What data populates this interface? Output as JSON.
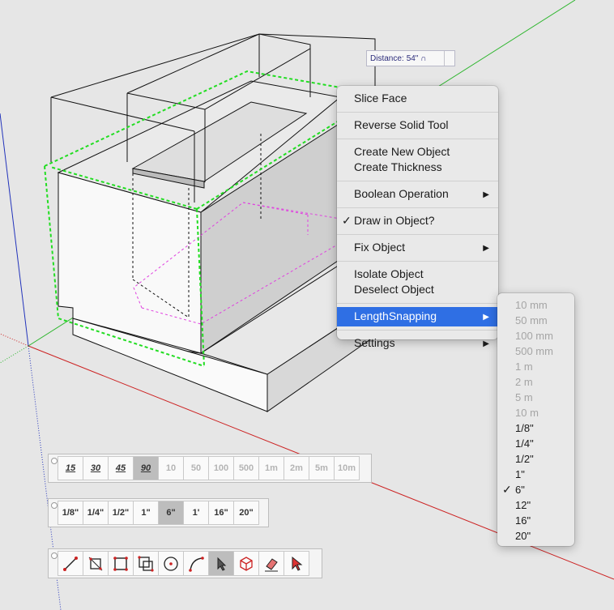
{
  "vcb": {
    "label": "Distance:",
    "value": "54\" ∩"
  },
  "context_menu": {
    "items": [
      {
        "lines": [
          "Slice Face"
        ]
      },
      {
        "lines": [
          "Reverse Solid Tool"
        ]
      },
      {
        "lines": [
          "Create New Object",
          "Create Thickness"
        ]
      },
      {
        "lines": [
          "Boolean Operation"
        ],
        "submenu": true
      },
      {
        "lines": [
          "Draw in Object?"
        ],
        "checked": true
      },
      {
        "lines": [
          "Fix Object"
        ],
        "submenu": true
      },
      {
        "lines": [
          "Isolate Object",
          "Deselect Object"
        ]
      },
      {
        "lines": [
          "LengthSnapping"
        ],
        "submenu": true,
        "highlighted": true
      },
      {
        "lines": [
          "Settings"
        ],
        "submenu": true
      }
    ]
  },
  "length_snapping_menu": {
    "items": [
      {
        "label": "10 mm",
        "enabled": false
      },
      {
        "label": "50 mm",
        "enabled": false
      },
      {
        "label": "100 mm",
        "enabled": false
      },
      {
        "label": "500 mm",
        "enabled": false
      },
      {
        "label": "1 m",
        "enabled": false
      },
      {
        "label": "2 m",
        "enabled": false
      },
      {
        "label": "5 m",
        "enabled": false
      },
      {
        "label": "10 m",
        "enabled": false
      },
      {
        "label": "1/8\"",
        "enabled": true
      },
      {
        "label": "1/4\"",
        "enabled": true
      },
      {
        "label": "1/2\"",
        "enabled": true
      },
      {
        "label": "1\"",
        "enabled": true
      },
      {
        "label": "6\"",
        "enabled": true,
        "checked": true
      },
      {
        "label": "12\"",
        "enabled": true
      },
      {
        "label": "16\"",
        "enabled": true
      },
      {
        "label": "20\"",
        "enabled": true
      }
    ]
  },
  "angle_toolbar": {
    "buttons": [
      {
        "label": "15",
        "kind": "angle"
      },
      {
        "label": "30",
        "kind": "angle"
      },
      {
        "label": "45",
        "kind": "angle"
      },
      {
        "label": "90",
        "kind": "angle",
        "active": true
      },
      {
        "label": "10",
        "kind": "dim"
      },
      {
        "label": "50",
        "kind": "dim"
      },
      {
        "label": "100",
        "kind": "dim"
      },
      {
        "label": "500",
        "kind": "dim"
      },
      {
        "label": "1m",
        "kind": "dim"
      },
      {
        "label": "2m",
        "kind": "dim"
      },
      {
        "label": "5m",
        "kind": "dim"
      },
      {
        "label": "10m",
        "kind": "dim"
      }
    ]
  },
  "length_toolbar": {
    "buttons": [
      {
        "label": "1/8\""
      },
      {
        "label": "1/4\""
      },
      {
        "label": "1/2\""
      },
      {
        "label": "1\""
      },
      {
        "label": "6\"",
        "active": true
      },
      {
        "label": "1'"
      },
      {
        "label": "16\""
      },
      {
        "label": "20\""
      }
    ]
  },
  "tools_toolbar": {
    "buttons": [
      {
        "icon": "line-tool-icon"
      },
      {
        "icon": "rotated-rectangle-icon"
      },
      {
        "icon": "rectangle-icon"
      },
      {
        "icon": "offset-rectangle-icon"
      },
      {
        "icon": "circle-icon"
      },
      {
        "icon": "arc-icon"
      },
      {
        "icon": "select-in-object-icon",
        "active": true
      },
      {
        "icon": "solid-box-icon"
      },
      {
        "icon": "eraser-icon"
      },
      {
        "icon": "select-arrow-icon"
      }
    ]
  },
  "colors": {
    "accent": "#2f6fe4",
    "selection_green": "#22dd22",
    "hidden_magenta": "#e040e0",
    "axis_red": "#cc2222",
    "axis_green": "#2bb52b",
    "axis_blue": "#2233bb"
  }
}
